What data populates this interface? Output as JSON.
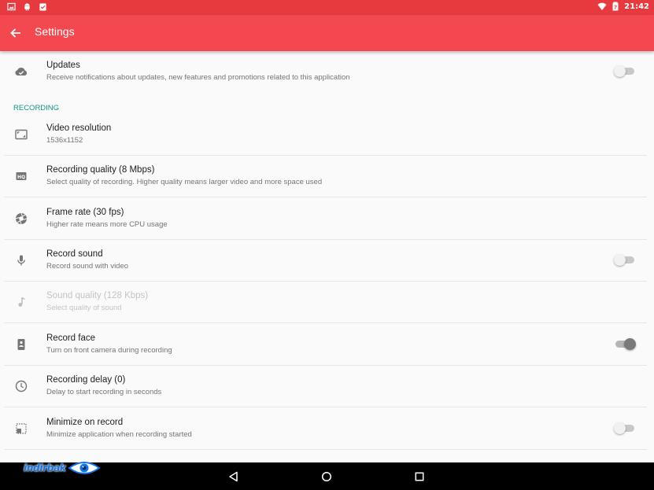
{
  "status_bar": {
    "time": "21:42",
    "left_icons": [
      "image-icon",
      "android-icon",
      "clipboard-check-icon"
    ],
    "right_icons": [
      "wifi-icon",
      "battery-icon"
    ]
  },
  "app_bar": {
    "title": "Settings",
    "background": "#f44850",
    "status_background": "#e63a3f"
  },
  "section_recording": "RECORDING",
  "accent_color": "#159588",
  "rows": [
    {
      "key": "updates",
      "title": "Updates",
      "summary": "Receive notifications about updates, new features and promotions related to this application",
      "icon": "cloud-check-icon",
      "toggle": false
    },
    {
      "key": "video-resolution",
      "title": "Video resolution",
      "summary": "1536x1152",
      "icon": "aspect-ratio-icon"
    },
    {
      "key": "recording-quality",
      "title": "Recording quality (8 Mbps)",
      "summary": "Select quality of recording. Higher quality means larger video and more space used",
      "icon": "hq-icon"
    },
    {
      "key": "frame-rate",
      "title": "Frame rate (30 fps)",
      "summary": "Higher rate means more CPU usage",
      "icon": "shutter-icon"
    },
    {
      "key": "record-sound",
      "title": "Record sound",
      "summary": "Record sound with video",
      "icon": "microphone-icon",
      "toggle": false
    },
    {
      "key": "sound-quality",
      "title": "Sound quality (128 Kbps)",
      "summary": "Select quality of sound",
      "icon": "music-note-icon",
      "disabled": true
    },
    {
      "key": "record-face",
      "title": "Record face",
      "summary": "Turn on front camera during recording",
      "icon": "front-camera-icon",
      "toggle": true
    },
    {
      "key": "recording-delay",
      "title": "Recording delay (0)",
      "summary": "Delay to start recording in seconds",
      "icon": "clock-icon"
    },
    {
      "key": "minimize-on-record",
      "title": "Minimize on record",
      "summary": "Minimize application when recording started",
      "icon": "minimize-window-icon",
      "toggle": false
    }
  ],
  "nav_bar": {
    "buttons": [
      "back-triangle-icon",
      "home-circle-icon",
      "recents-square-icon"
    ]
  },
  "watermark": {
    "text": "indirbak"
  }
}
